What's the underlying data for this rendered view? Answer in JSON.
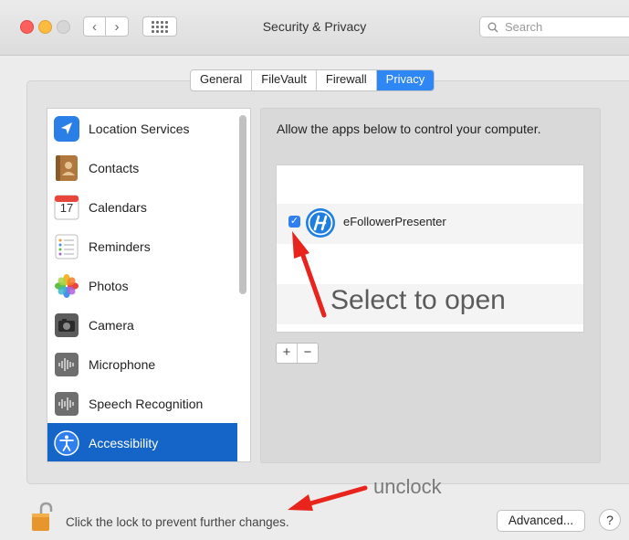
{
  "window": {
    "title": "Security & Privacy",
    "search_placeholder": "Search"
  },
  "tabs": [
    {
      "label": "General",
      "active": false
    },
    {
      "label": "FileVault",
      "active": false
    },
    {
      "label": "Firewall",
      "active": false
    },
    {
      "label": "Privacy",
      "active": true
    }
  ],
  "sidebar": {
    "items": [
      {
        "label": "Location Services",
        "icon": "location-arrow-icon",
        "selected": false
      },
      {
        "label": "Contacts",
        "icon": "contacts-book-icon",
        "selected": false
      },
      {
        "label": "Calendars",
        "icon": "calendar-icon",
        "selected": false
      },
      {
        "label": "Reminders",
        "icon": "reminders-list-icon",
        "selected": false
      },
      {
        "label": "Photos",
        "icon": "photos-flower-icon",
        "selected": false
      },
      {
        "label": "Camera",
        "icon": "camera-icon",
        "selected": false
      },
      {
        "label": "Microphone",
        "icon": "microphone-waveform-icon",
        "selected": false
      },
      {
        "label": "Speech Recognition",
        "icon": "speech-waveform-icon",
        "selected": false
      },
      {
        "label": "Accessibility",
        "icon": "accessibility-person-icon",
        "selected": true
      }
    ],
    "calendar_day": "17"
  },
  "right_pane": {
    "description": "Allow the apps below to control your computer.",
    "apps": [
      {
        "name": "eFollowerPresenter",
        "checked": true,
        "icon": "efollower-app-icon"
      }
    ],
    "add_label": "+",
    "remove_label": "−"
  },
  "annotations": {
    "select_to_open": "Select to open",
    "unclock": "unclock",
    "arrow_color": "#e8251d"
  },
  "footer": {
    "lock_text": "Click the lock to prevent further changes.",
    "advanced_label": "Advanced...",
    "help_label": "?"
  },
  "colors": {
    "selection_blue": "#1565c9",
    "tab_active": "#2f87f5",
    "checkbox": "#2f7ff1"
  }
}
